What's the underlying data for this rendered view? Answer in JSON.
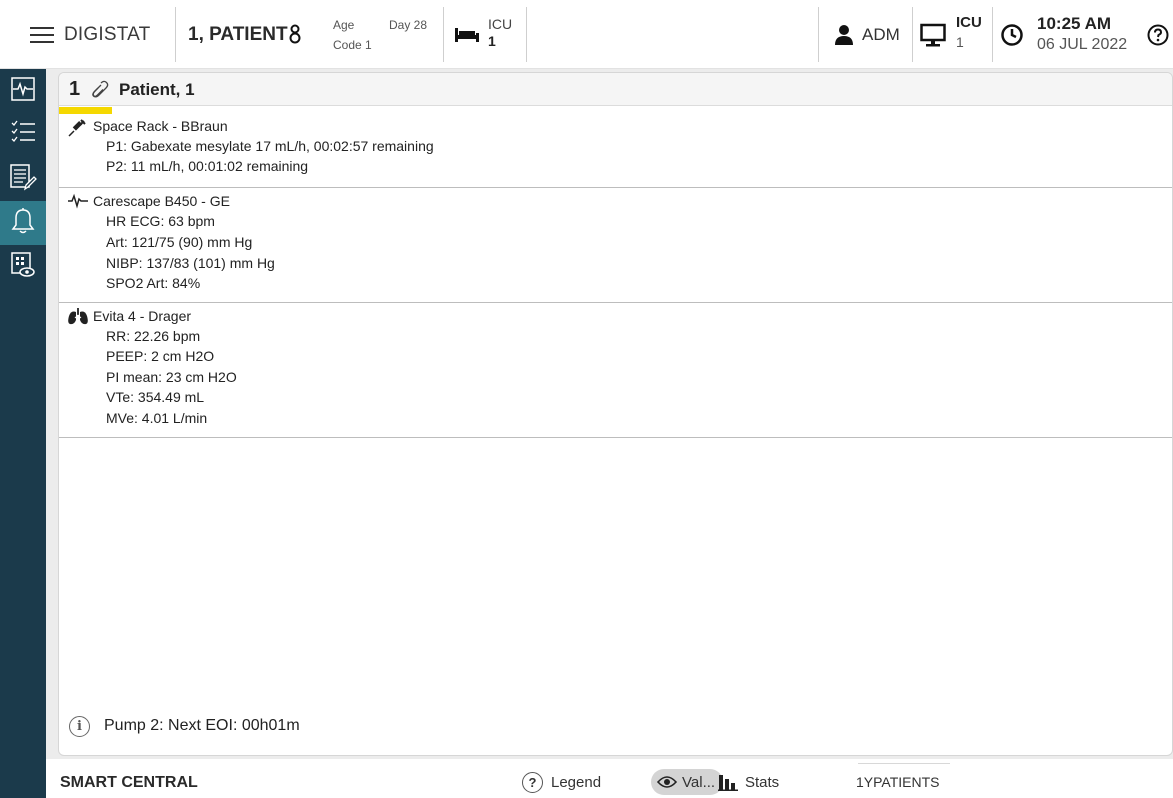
{
  "header": {
    "app_name": "DIGISTAT",
    "patient_name": "1, PATIENT",
    "age_label": "Age",
    "day_label": "Day 28",
    "code_label": "Code 1",
    "location_top": "ICU",
    "location_bed": "1",
    "user": "ADM",
    "workstation_top": "ICU",
    "workstation_num": "1",
    "time": "10:25 AM",
    "date": "06 JUL 2022"
  },
  "sidebar": {
    "items": [
      {
        "icon": "vital-signs-icon"
      },
      {
        "icon": "checklist-icon"
      },
      {
        "icon": "notes-edit-icon"
      },
      {
        "icon": "bell-icon",
        "active": true
      },
      {
        "icon": "monitor-view-icon"
      }
    ]
  },
  "patient_card": {
    "bed_number": "1",
    "name": "Patient, 1",
    "alarm_color": "#f5d800",
    "devices": [
      {
        "icon": "syringe-icon",
        "name": "Space Rack - BBraun",
        "lines": [
          "P1: Gabexate mesylate 17 mL/h, 00:02:57 remaining",
          "P2: 11 mL/h, 00:01:02 remaining"
        ]
      },
      {
        "icon": "ecg-waveform-icon",
        "name": "Carescape B450 - GE",
        "lines": [
          "HR ECG: 63 bpm",
          "Art: 121/75 (90) mm Hg",
          "NIBP: 137/83 (101) mm Hg",
          "SPO2 Art: 84%"
        ]
      },
      {
        "icon": "lungs-icon",
        "name": "Evita 4 - Drager",
        "lines": [
          "RR: 22.26 bpm",
          "PEEP:  2 cm H2O",
          "PI mean: 23 cm H2O",
          "VTe: 354.49 mL",
          "MVe: 4.01 L/min"
        ]
      }
    ],
    "info_message": "Pump 2: Next EOI: 00h01m"
  },
  "footer": {
    "title": "SMART CENTRAL",
    "legend_label": "Legend",
    "values_label": "Val...",
    "stats_label": "Stats",
    "patients_label": "1YPATIENTS"
  },
  "colors": {
    "sidebar_bg": "#1b3a4b",
    "sidebar_active": "#2f7a8a",
    "alarm_yellow": "#f5d800"
  }
}
